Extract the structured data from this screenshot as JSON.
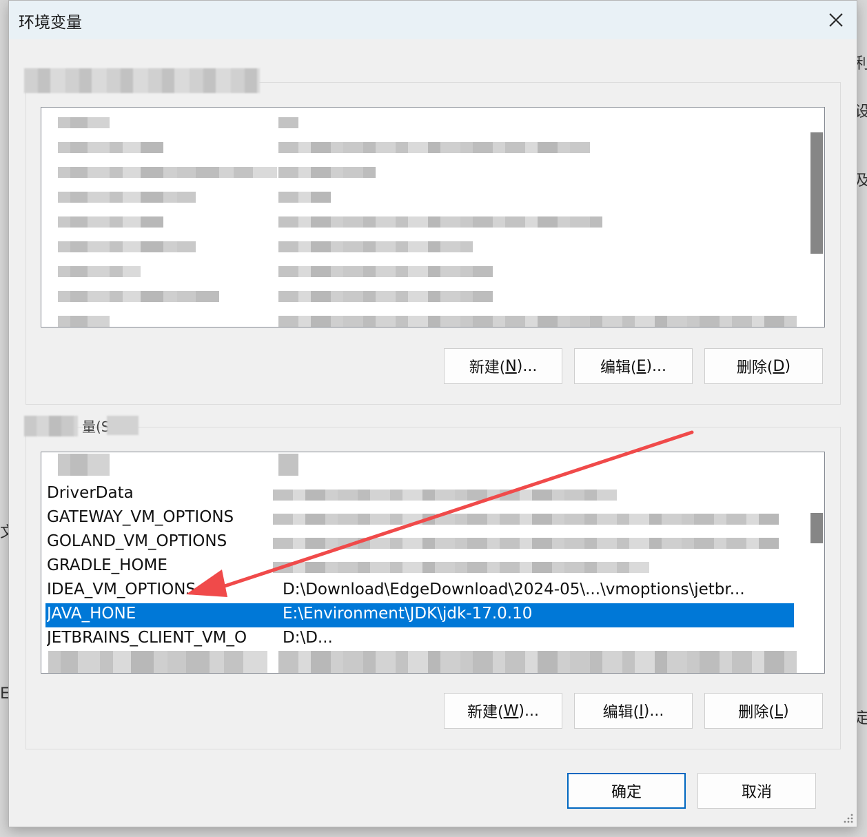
{
  "dialog": {
    "title": "环境变量"
  },
  "user_section": {
    "buttons": {
      "new": {
        "pre": "新建(",
        "key": "N",
        "post": ")..."
      },
      "edit": {
        "pre": "编辑(",
        "key": "E",
        "post": ")..."
      },
      "delete": {
        "pre": "删除(",
        "key": "D",
        "post": ")"
      }
    }
  },
  "system_section": {
    "label_visible": "量(S)",
    "rows": [
      {
        "name": "DriverData",
        "value": ""
      },
      {
        "name": "GATEWAY_VM_OPTIONS",
        "value": ""
      },
      {
        "name": "GOLAND_VM_OPTIONS",
        "value": ""
      },
      {
        "name": "GRADLE_HOME",
        "value": ""
      },
      {
        "name": "IDEA_VM_OPTIONS",
        "value": "D:\\Download\\EdgeDownload\\2024-05\\...\\vmoptions\\jetbr..."
      },
      {
        "name": "JAVA_HONE",
        "value": "E:\\Environment\\JDK\\jdk-17.0.10",
        "selected": true
      },
      {
        "name": "JETBRAINS_CLIENT_VM_O",
        "value": "D:\\D..."
      }
    ],
    "buttons": {
      "new": {
        "pre": "新建(",
        "key": "W",
        "post": ")..."
      },
      "edit": {
        "pre": "编辑(",
        "key": "I",
        "post": ")..."
      },
      "delete": {
        "pre": "删除(",
        "key": "L",
        "post": ")"
      }
    }
  },
  "footer": {
    "ok": "确定",
    "cancel": "取消"
  },
  "background_edge_text": [
    "利",
    "设",
    "及",
    "文",
    "E",
    "定"
  ],
  "colors": {
    "selection": "#0078d7",
    "arrow": "#f04a4a",
    "primary_border": "#0067c0"
  },
  "icons": {
    "close": "close-icon",
    "resize": "resize-grip-icon"
  }
}
